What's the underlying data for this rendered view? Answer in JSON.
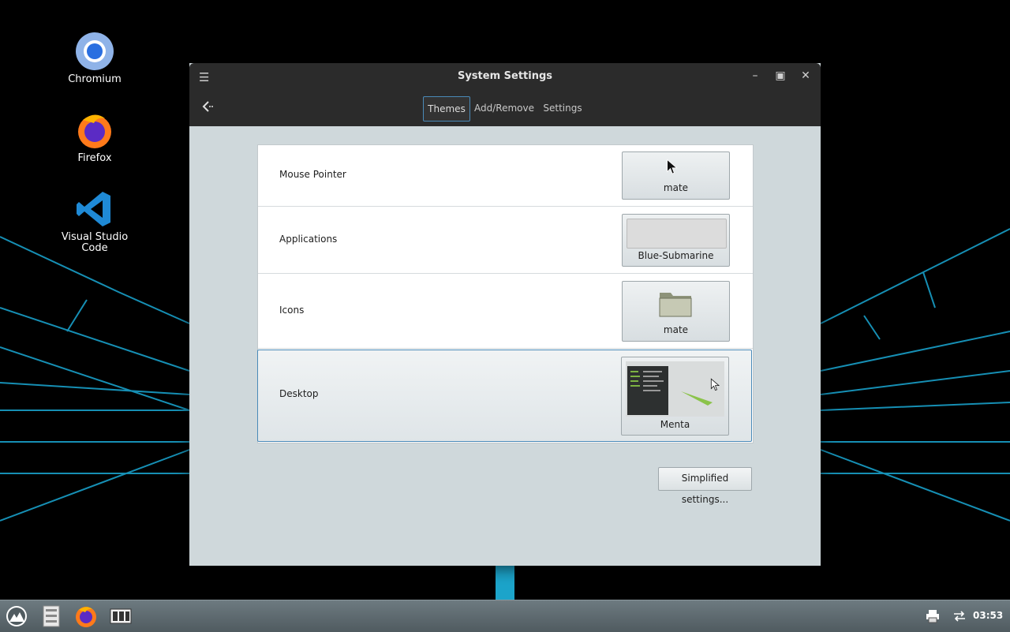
{
  "desktop": {
    "icons": [
      {
        "label": "Chromium",
        "icon": "chromium-icon"
      },
      {
        "label": "Firefox",
        "icon": "firefox-icon"
      },
      {
        "label": "Visual Studio\nCode",
        "icon": "vscode-icon"
      }
    ]
  },
  "window": {
    "title": "System Settings",
    "menu_icon": "hamburger-icon",
    "controls": [
      "minimize-icon",
      "maximize-icon",
      "close-icon"
    ],
    "back_icon": "back-arrow-icon",
    "tabs": [
      {
        "label": "Themes",
        "active": true
      },
      {
        "label": "Add/Remove",
        "active": false
      },
      {
        "label": "Settings",
        "active": false
      }
    ],
    "themes": [
      {
        "label": "Mouse Pointer",
        "value": "mate",
        "preview": "cursor-arrow"
      },
      {
        "label": "Applications",
        "value": "Blue-Submarine",
        "preview": "blank-window"
      },
      {
        "label": "Icons",
        "value": "mate",
        "preview": "folder"
      },
      {
        "label": "Desktop",
        "value": "Menta",
        "preview": "desktop-screenshot",
        "selected": true
      }
    ],
    "simplified_button": "Simplified settings..."
  },
  "taskbar": {
    "items": [
      "menu-icon",
      "file-manager-icon",
      "firefox-icon",
      "settings-panel-icon"
    ],
    "tray": [
      "printer-icon",
      "network-icon"
    ],
    "clock": "03:53"
  },
  "colors": {
    "accent": "#4a8ab8",
    "titlebar": "#2b2b2b",
    "window_bg": "#cfd8db",
    "neon": "#1fb6e0"
  }
}
